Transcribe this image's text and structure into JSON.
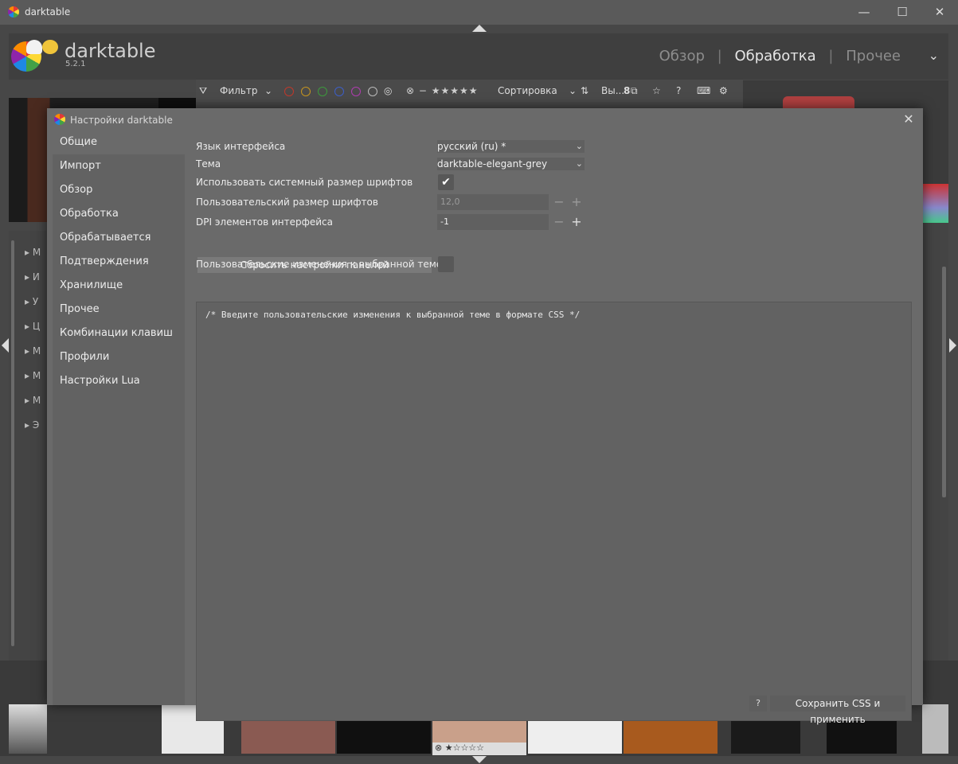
{
  "window": {
    "title": "darktable"
  },
  "header": {
    "app_name": "darktable",
    "version": "5.2.1",
    "views": [
      {
        "label": "Обзор"
      },
      {
        "label": "Обработка"
      },
      {
        "label": "Прочее"
      }
    ]
  },
  "toolbar": {
    "filter_label": "Фильтр",
    "sort_label": "Сортировка",
    "select_label": "Вы...",
    "count": "8"
  },
  "left_panel": {
    "items": [
      "М",
      "И",
      "У",
      "Ц",
      "М",
      "М",
      "М",
      "Э"
    ]
  },
  "filmstrip": {
    "rating_stars": "★☆☆☆☆"
  },
  "dialog": {
    "title": "Настройки darktable",
    "sidebar": [
      "Общие",
      "Импорт",
      "Обзор",
      "Обработка",
      "Обрабатывается",
      "Подтверждения",
      "Хранилище",
      "Прочее",
      "Комбинации клавиш",
      "Профили",
      "Настройки Lua"
    ],
    "settings": {
      "language_label": "Язык интерфейса",
      "language_value": "русский (ru) *",
      "theme_label": "Тема",
      "theme_value": "darktable-elegant-grey",
      "sys_font_label": "Использовать системный размер шрифтов",
      "sys_font_checked": true,
      "custom_font_label": "Пользовательский размер шрифтов",
      "custom_font_value": "12,0",
      "dpi_label": "DPI элементов интерфейса",
      "dpi_value": "-1",
      "reset_button": "Сбросить настройки панелей",
      "theme_mods_label": "Пользовательские изменения к выбранной теме",
      "theme_mods_checked": false,
      "css_text": "/* Введите пользовательские изменения к выбранной теме в формате CSS  */",
      "help_button": "?",
      "save_button": "Сохранить CSS и применить"
    }
  }
}
